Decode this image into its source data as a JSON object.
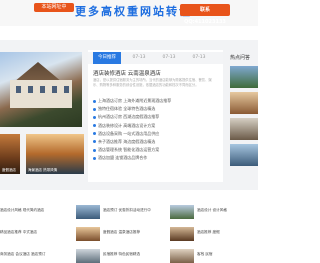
{
  "banner": {
    "badge": "本站网址中",
    "promo": "更多高权重网站转让",
    "qq": "联系QQ:411023133",
    "sub": ""
  },
  "tabs": [
    {
      "label": "今日推荐",
      "active": true
    },
    {
      "label": "07-13",
      "active": false
    },
    {
      "label": "07-13",
      "active": false
    },
    {
      "label": "07-13",
      "active": false
    }
  ],
  "feature": {
    "title": "酒店装修酒店 云南温泉酒店",
    "desc": "酒店，是以提供住宿服务为主的场所，当代的酒店能够为顾客提供住宿、餐饮、娱乐、购物等多种服务的综合性设施，依据酒店的功能和档次不同而区分。"
  },
  "list": [
    "上海酒店订房 上海外滩附近景观酒店推荐",
    "独特住宿体验 全球特色酒店精选",
    "杭州酒店订房 西湖边度假酒店推荐",
    "酒店装修设计 高端酒店设计方案",
    "酒店设备采购 一站式酒店用品供应",
    "亲子酒店推荐 海边度假酒店精选",
    "酒店管理系统 智能化酒店运营方案",
    "酒店加盟 连锁酒店品牌合作"
  ],
  "hero_caption": "",
  "thumbs": [
    {
      "caption": "度假酒店"
    },
    {
      "caption": "海景酒店 热带风情"
    }
  ],
  "sidebar": {
    "title": "热点问答"
  },
  "bottom": [
    {
      "text": "酒店设计风格 现代简约酒店"
    },
    {
      "text": "酒店预订 优惠折扣活动进行中"
    },
    {
      "text": "酒店设计 设计风格"
    },
    {
      "text": "精品酒店推荐 中式酒店"
    },
    {
      "text": "度假酒店 温泉酒店推荐"
    },
    {
      "text": "酒店推荐 度假"
    },
    {
      "text": "商务酒店 会议酒店 酒店预订"
    },
    {
      "text": "民宿推荐 特色民宿精选"
    },
    {
      "text": "客栈 民宿"
    }
  ]
}
